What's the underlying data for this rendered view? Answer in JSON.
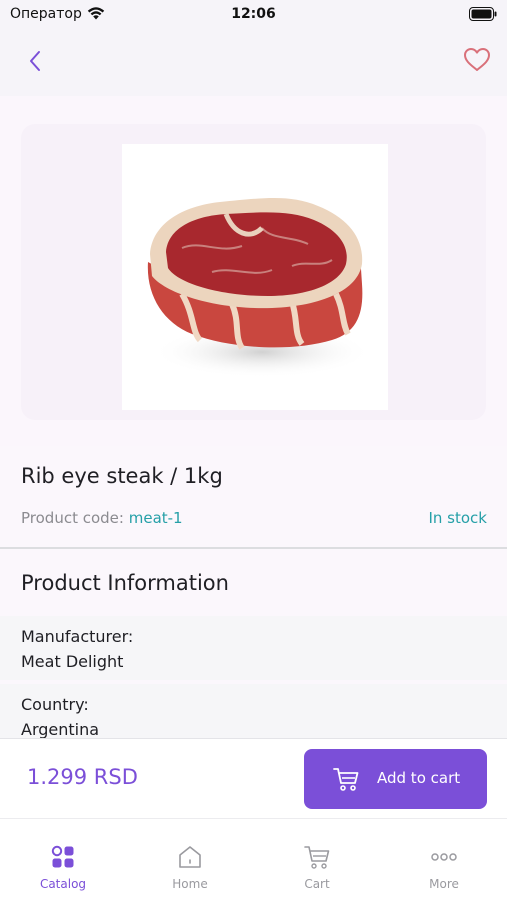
{
  "status_bar": {
    "carrier": "Оператор",
    "time": "12:06"
  },
  "header": {
    "back_icon": "chevron-left-icon",
    "favorite_icon": "heart-icon"
  },
  "product": {
    "title": "Rib eye steak / 1kg",
    "code_label": "Product code:",
    "code_value": "meat-1",
    "stock_status": "In stock"
  },
  "info": {
    "section_title": "Product Information",
    "items": [
      {
        "label": "Manufacturer:",
        "value": "Meat Delight"
      },
      {
        "label": "Country:",
        "value": "Argentina"
      }
    ]
  },
  "cart_bar": {
    "price": "1.299 RSD",
    "add_button_label": "Add to cart"
  },
  "tabs": [
    {
      "label": "Catalog",
      "icon": "catalog-icon",
      "active": true
    },
    {
      "label": "Home",
      "icon": "home-icon",
      "active": false
    },
    {
      "label": "Cart",
      "icon": "cart-icon",
      "active": false
    },
    {
      "label": "More",
      "icon": "more-icon",
      "active": false
    }
  ],
  "colors": {
    "accent": "#7b4fd8",
    "teal": "#26a0a8",
    "heart": "#d9707a"
  }
}
